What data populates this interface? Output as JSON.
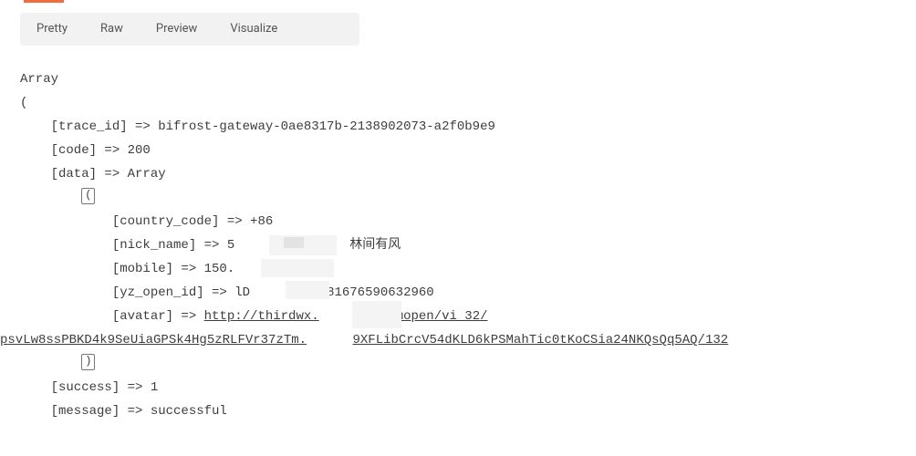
{
  "tabs": {
    "pretty": "Pretty",
    "raw": "Raw",
    "preview": "Preview",
    "visualize": "Visualize"
  },
  "response": {
    "l0": "Array",
    "l1": "(",
    "l2": "    [trace_id] => bifrost-gateway-0ae8317b-2138902073-a2f0b9e9",
    "l3": "    [code] => 200",
    "l4": "    [data] => Array",
    "l5_pad": "        ",
    "l5_mark": "(",
    "l6": "            [country_code] => +86",
    "l7_a": "            [nick_name] => 5",
    "l7_b": "林间有风",
    "l8": "            [mobile] => 150.",
    "l9_a": "            [yz_open_id] => lD",
    "l9_b": "87581676590632960",
    "l10_a": "            [avatar] => ",
    "l10_b": "http://thirdwx.",
    "l10_c": "cn/mmopen/vi_32/",
    "l11_a": "psvLw8ssPBKD4k9SeUiaGPSk4Hg5zRLFVr37zTm.",
    "l11_b": "9XFLibCrcV54dKLD6kPSMahTic0tKoCSia24NKQsQq5AQ/132",
    "l12_pad": "        ",
    "l12_mark": ")",
    "l13": "",
    "l14": "    [success] => 1",
    "l15": "    [message] => successful"
  }
}
